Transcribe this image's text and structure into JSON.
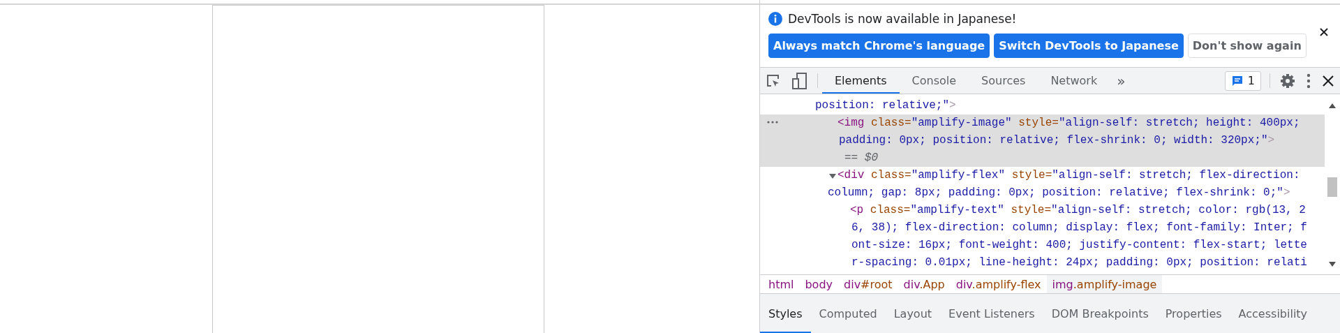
{
  "banner": {
    "message": "DevTools is now available in Japanese!",
    "buttons": [
      {
        "label": "Always match Chrome's language",
        "kind": "primary"
      },
      {
        "label": "Switch DevTools to Japanese",
        "kind": "primary"
      },
      {
        "label": "Don't show again",
        "kind": "secondary"
      }
    ]
  },
  "toolbar": {
    "tabs": [
      {
        "label": "Elements",
        "selected": true
      },
      {
        "label": "Console",
        "selected": false
      },
      {
        "label": "Sources",
        "selected": false
      },
      {
        "label": "Network",
        "selected": false
      }
    ],
    "more": "»",
    "issues_count": "1"
  },
  "elements": {
    "lines_above": [
      [
        {
          "kind": "value",
          "text": "position: relative;\""
        },
        {
          "kind": "bracket",
          "text": ">"
        }
      ]
    ],
    "nodes": [
      {
        "kind": "leaf",
        "selected": true,
        "ref": "== *$0*",
        "lines": [
          [
            {
              "kind": "tag",
              "text": "<img"
            },
            {
              "kind": "attr",
              "text": " class="
            },
            {
              "kind": "value",
              "text": "\"amplify-image\""
            },
            {
              "kind": "attr",
              "text": " style="
            },
            {
              "kind": "value",
              "text": "\"align-self: stretch; height: 400px;"
            }
          ],
          [
            {
              "kind": "value",
              "text": "padding: 0px; position: relative; flex-shrink: 0; width: 320px;\""
            },
            {
              "kind": "bracket",
              "text": ">"
            }
          ]
        ]
      },
      {
        "kind": "branch",
        "expanded": true,
        "selected": false,
        "lines": [
          [
            {
              "kind": "tag",
              "text": "<div"
            },
            {
              "kind": "attr",
              "text": " class="
            },
            {
              "kind": "value",
              "text": "\"amplify-flex\""
            },
            {
              "kind": "attr",
              "text": " style="
            },
            {
              "kind": "value",
              "text": "\"align-self: stretch; flex-direction:"
            }
          ],
          [
            {
              "kind": "value",
              "text": "column; gap: 8px; padding: 0px; position: relative; flex-shrink: 0;\""
            },
            {
              "kind": "bracket",
              "text": ">"
            }
          ]
        ],
        "children": [
          {
            "kind": "leaf",
            "selected": false,
            "lines": [
              [
                {
                  "kind": "tag",
                  "text": "<p"
                },
                {
                  "kind": "attr",
                  "text": " class="
                },
                {
                  "kind": "value",
                  "text": "\"amplify-text\""
                },
                {
                  "kind": "attr",
                  "text": " style="
                },
                {
                  "kind": "value",
                  "text": "\"align-self: stretch; color: rgb(13, 2"
                }
              ],
              [
                {
                  "kind": "value",
                  "text": "6, 38); flex-direction: column; display: flex; font-family: Inter; f"
                }
              ],
              [
                {
                  "kind": "value",
                  "text": "ont-size: 16px; font-weight: 400; justify-content: flex-start; lette"
                }
              ],
              [
                {
                  "kind": "value",
                  "text": "r-spacing: 0.01px; line-height: 24px; padding: 0px; position: relati"
                }
              ]
            ]
          }
        ]
      }
    ]
  },
  "breadcrumbs": [
    {
      "tag": "html",
      "selected": false
    },
    {
      "tag": "body",
      "selected": false
    },
    {
      "tag": "div",
      "suffix": "#root",
      "selected": false
    },
    {
      "tag": "div",
      "suffix": ".App",
      "selected": false
    },
    {
      "tag": "div",
      "suffix": ".amplify-flex",
      "selected": false
    },
    {
      "tag": "img",
      "suffix": ".amplify-image",
      "selected": true
    }
  ],
  "panel_tabs": [
    {
      "label": "Styles",
      "selected": true
    },
    {
      "label": "Computed",
      "selected": false
    },
    {
      "label": "Layout",
      "selected": false
    },
    {
      "label": "Event Listeners",
      "selected": false
    },
    {
      "label": "DOM Breakpoints",
      "selected": false
    },
    {
      "label": "Properties",
      "selected": false
    },
    {
      "label": "Accessibility",
      "selected": false
    }
  ]
}
